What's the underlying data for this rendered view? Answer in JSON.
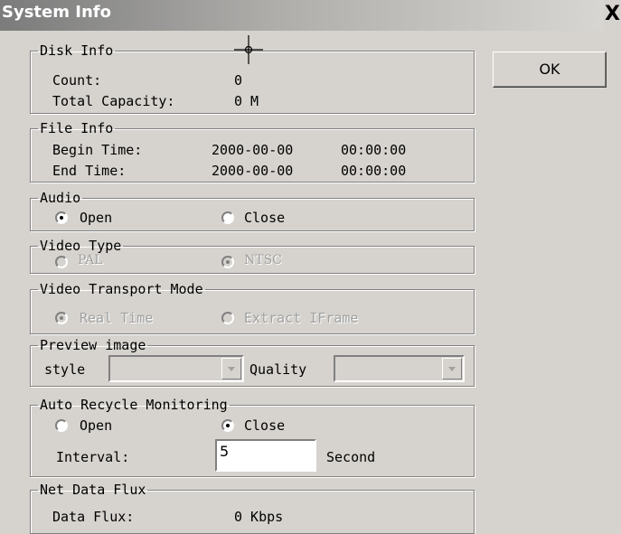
{
  "window": {
    "title": "System Info",
    "close_glyph": "X"
  },
  "ok_label": "OK",
  "disk_info": {
    "legend": "Disk Info",
    "count_label": "Count:",
    "count_value": "0",
    "capacity_label": "Total Capacity:",
    "capacity_value": "0 M"
  },
  "file_info": {
    "legend": "File Info",
    "begin_label": "Begin Time:",
    "begin_date": "2000-00-00",
    "begin_time": "00:00:00",
    "end_label": "End Time:",
    "end_date": "2000-00-00",
    "end_time": "00:00:00"
  },
  "audio": {
    "legend": "Audio",
    "open": "Open",
    "close": "Close",
    "selected": "Open"
  },
  "video_type": {
    "legend": "Video Type",
    "pal": "PAL",
    "ntsc": "NTSC",
    "selected": "NTSC",
    "enabled": false
  },
  "video_transport": {
    "legend": "Video Transport Mode",
    "real_time": "Real Time",
    "extract": "Extract IFrame",
    "selected": "Real Time",
    "enabled": false
  },
  "preview": {
    "legend": "Preview image",
    "style_label": "style",
    "style_value": "",
    "quality_label": "Quality",
    "quality_value": ""
  },
  "auto_recycle": {
    "legend": "Auto Recycle Monitoring",
    "open": "Open",
    "close": "Close",
    "selected": "Close",
    "interval_label": "Interval:",
    "interval_value": "5",
    "unit": "Second"
  },
  "net_flux": {
    "legend": "Net Data Flux",
    "label": "Data Flux:",
    "value": "0 Kbps"
  },
  "icons": {
    "cursor": "crosshair-cursor-icon",
    "close": "close-icon",
    "dropdown": "chevron-down-icon"
  },
  "colors": {
    "dialog_bg": "#d6d3ce",
    "titlebar_start": "#7b7b7b",
    "titlebar_end": "#d8d6d2",
    "disabled_text": "#a0a0a0"
  }
}
